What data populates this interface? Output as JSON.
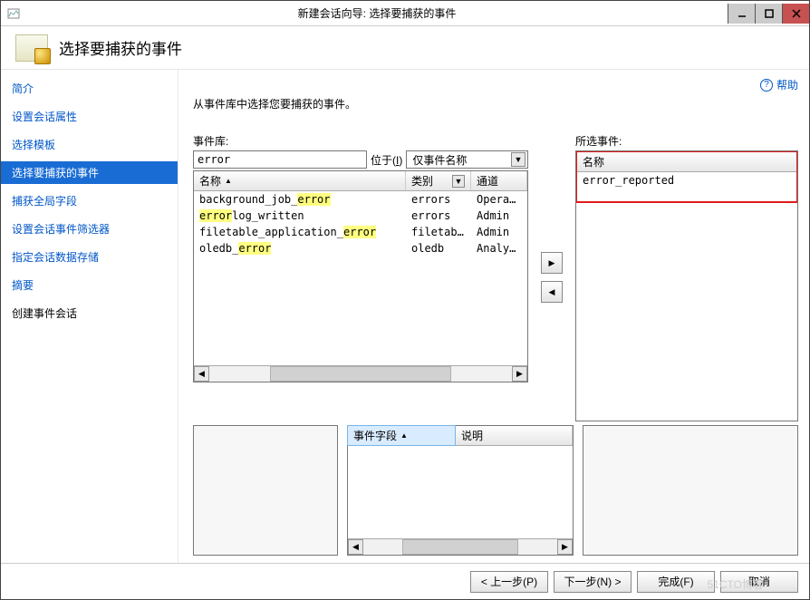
{
  "window": {
    "title": "新建会话向导: 选择要捕获的事件"
  },
  "header": {
    "title": "选择要捕获的事件"
  },
  "help": {
    "label": "帮助"
  },
  "sidebar": {
    "items": [
      {
        "label": "简介",
        "selected": false
      },
      {
        "label": "设置会话属性",
        "selected": false
      },
      {
        "label": "选择模板",
        "selected": false
      },
      {
        "label": "选择要捕获的事件",
        "selected": true
      },
      {
        "label": "捕获全局字段",
        "selected": false
      },
      {
        "label": "设置会话事件筛选器",
        "selected": false
      },
      {
        "label": "指定会话数据存储",
        "selected": false
      },
      {
        "label": "摘要",
        "selected": false
      },
      {
        "label": "创建事件会话",
        "selected": false,
        "plain": true
      }
    ]
  },
  "main": {
    "intro": "从事件库中选择您要捕获的事件。",
    "library": {
      "label": "事件库:",
      "search_value": "error",
      "located_label_pre": "位于(",
      "located_label_key": "I",
      "located_label_post": ")",
      "located_value": "仅事件名称",
      "columns": {
        "name": "名称",
        "category": "类别",
        "channel": "通道"
      },
      "rows": [
        {
          "name": [
            {
              "t": "background_job_",
              "hl": false
            },
            {
              "t": "error",
              "hl": true
            }
          ],
          "category": "errors",
          "channel": "Operatio"
        },
        {
          "name": [
            {
              "t": "error",
              "hl": true
            },
            {
              "t": "log_written",
              "hl": false
            }
          ],
          "category": "errors",
          "channel": "Admin"
        },
        {
          "name": [
            {
              "t": "filetable_application_",
              "hl": false
            },
            {
              "t": "error",
              "hl": true
            }
          ],
          "category": "filetable",
          "channel": "Admin"
        },
        {
          "name": [
            {
              "t": "oledb_",
              "hl": false
            },
            {
              "t": "error",
              "hl": true
            }
          ],
          "category": "oledb",
          "channel": "Analytic"
        }
      ]
    },
    "selected": {
      "label": "所选事件:",
      "col": "名称",
      "rows": [
        "error_reported"
      ]
    },
    "fieldsPanel": {
      "col1": "事件字段",
      "col2": "说明"
    }
  },
  "buttons": {
    "back": "< 上一步(P)",
    "next": "下一步(N) >",
    "finish": "完成(F)",
    "cancel": "取消"
  },
  "watermark": "51CTO博客"
}
